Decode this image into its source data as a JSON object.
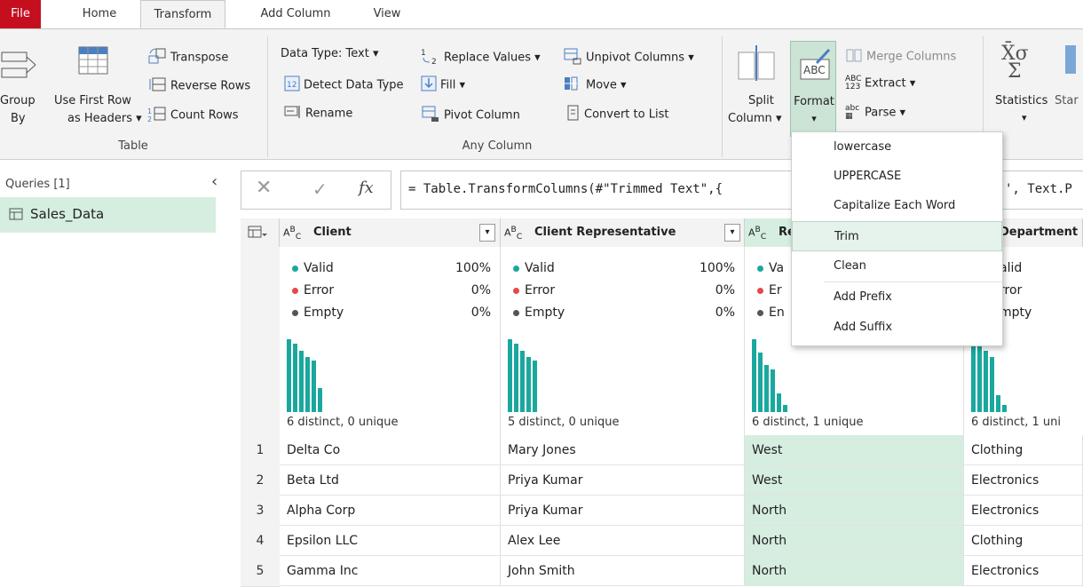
{
  "tabs": [
    "File",
    "Home",
    "Transform",
    "Add Column",
    "View"
  ],
  "ribbon": {
    "group_by_line1": "Group",
    "group_by_line2": "By",
    "first_row_line1": "Use First Row",
    "first_row_line2": "as Headers",
    "transpose": "Transpose",
    "reverse_rows": "Reverse Rows",
    "count_rows": "Count Rows",
    "table_group": "Table",
    "data_type": "Data Type: Text",
    "detect_data_type": "Detect Data Type",
    "rename": "Rename",
    "replace_values": "Replace Values",
    "fill": "Fill",
    "pivot_column": "Pivot Column",
    "unpivot_columns": "Unpivot Columns",
    "move": "Move",
    "convert_to_list": "Convert to List",
    "any_column_group": "Any Column",
    "split_line1": "Split",
    "split_line2": "Column",
    "format": "Format",
    "merge_columns": "Merge Columns",
    "extract": "Extract",
    "parse": "Parse",
    "statistics": "Statistics",
    "standard_partial": "Star",
    "abc_123": "ABC\n123",
    "abc_small": "abc"
  },
  "queries": {
    "title": "Queries [1]",
    "items": [
      "Sales_Data"
    ]
  },
  "formula": {
    "text": "= Table.TransformColumns(#\"Trimmed Text\",{",
    "tail": "', Text.P"
  },
  "columns": [
    {
      "name": "Client",
      "valid": "100%",
      "error": "0%",
      "empty": "0%",
      "distinct": "6 distinct, 0 unique",
      "bars": [
        0.85,
        0.8,
        0.72,
        0.65,
        0.6,
        0.28
      ]
    },
    {
      "name": "Client Representative",
      "valid": "100%",
      "error": "0%",
      "empty": "0%",
      "distinct": "5 distinct, 0 unique",
      "bars": [
        0.85,
        0.8,
        0.72,
        0.65,
        0.6
      ]
    },
    {
      "name": "Re",
      "valid": "Va",
      "error": "Er",
      "empty": "En",
      "distinct": "6 distinct, 1 unique",
      "bars": [
        0.85,
        0.7,
        0.55,
        0.5,
        0.22,
        0.08
      ]
    },
    {
      "name": "Department",
      "valid": "alid",
      "error": "rror",
      "empty": "mpty",
      "distinct": "6 distinct, 1 uni",
      "bars": [
        0.85,
        0.8,
        0.72,
        0.65,
        0.2,
        0.08
      ]
    }
  ],
  "profile_labels": {
    "valid": "Valid",
    "error": "Error",
    "empty": "Empty"
  },
  "rows": [
    {
      "n": "1",
      "client": "Delta Co",
      "rep": "Mary Jones",
      "region": "West",
      "dept": "Clothing"
    },
    {
      "n": "2",
      "client": "Beta Ltd",
      "rep": "Priya Kumar",
      "region": "West",
      "dept": "Electronics"
    },
    {
      "n": "3",
      "client": "Alpha Corp",
      "rep": "Priya Kumar",
      "region": "North",
      "dept": "Electronics"
    },
    {
      "n": "4",
      "client": "Epsilon LLC",
      "rep": "Alex Lee",
      "region": "North",
      "dept": "Clothing"
    },
    {
      "n": "5",
      "client": "Gamma Inc",
      "rep": "John Smith",
      "region": "North",
      "dept": "Electronics"
    }
  ],
  "format_menu": [
    "lowercase",
    "UPPERCASE",
    "Capitalize Each Word",
    "Trim",
    "Clean",
    "Add Prefix",
    "Add Suffix"
  ],
  "colors": {
    "teal": "#1aa89e",
    "file_red": "#c50f1f",
    "selected_green": "#d5eee0",
    "valid_dot": "#1aa89e",
    "error_dot": "#e8474c",
    "empty_dot": "#555555"
  }
}
